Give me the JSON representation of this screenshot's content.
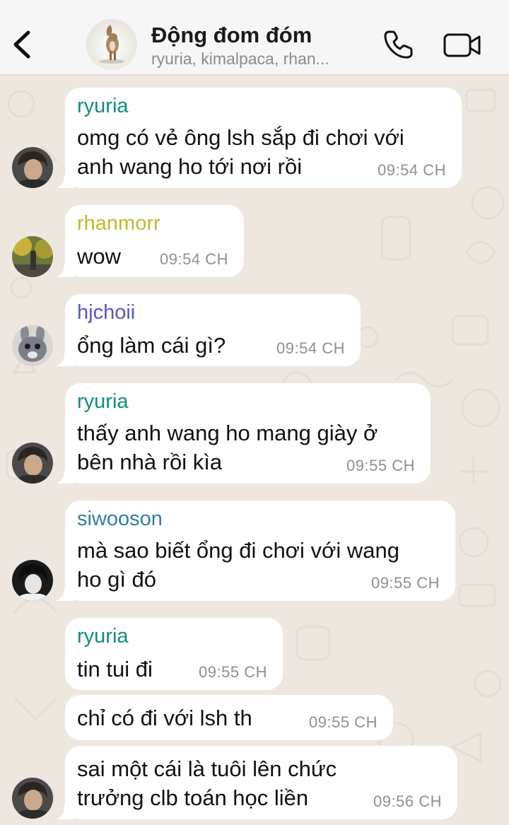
{
  "header": {
    "title": "Động đom đóm",
    "subtitle": "ryuria, kimalpaca, rhan..."
  },
  "colors": {
    "ryuria": "#128c7e",
    "rhanmorr": "#b7bf2c",
    "hjchoii": "#5a56c4",
    "siwooson": "#2f7fa6",
    "bubble": "#ffffff",
    "header_bg": "#f6f6f6",
    "chat_bg": "#ede7e0"
  },
  "messages": [
    {
      "sender": "ryuria",
      "lines": [
        "omg có vẻ ông lsh sắp đi chơi với",
        "anh wang ho tới nơi rồi"
      ],
      "time": "09:54 CH"
    },
    {
      "sender": "rhanmorr",
      "lines": [
        "wow"
      ],
      "time": "09:54 CH"
    },
    {
      "sender": "hjchoii",
      "lines": [
        "ổng làm cái gì?"
      ],
      "time": "09:54 CH"
    },
    {
      "sender": "ryuria",
      "lines": [
        "thấy anh wang ho mang giày ở",
        "bên nhà rồi kìa"
      ],
      "time": "09:55 CH"
    },
    {
      "sender": "siwooson",
      "lines": [
        "mà sao biết ổng đi chơi với wang",
        "ho gì đó"
      ],
      "time": "09:55 CH"
    },
    {
      "sender": "ryuria",
      "lines": [
        "tin tui đi"
      ],
      "time": "09:55 CH"
    },
    {
      "sender": "",
      "lines": [
        "chỉ có đi với lsh th"
      ],
      "time": "09:55 CH"
    },
    {
      "sender": "",
      "lines": [
        "sai một cái là tuôi lên chức",
        "trưởng clb toán học liền"
      ],
      "time": "09:56 CH"
    }
  ]
}
